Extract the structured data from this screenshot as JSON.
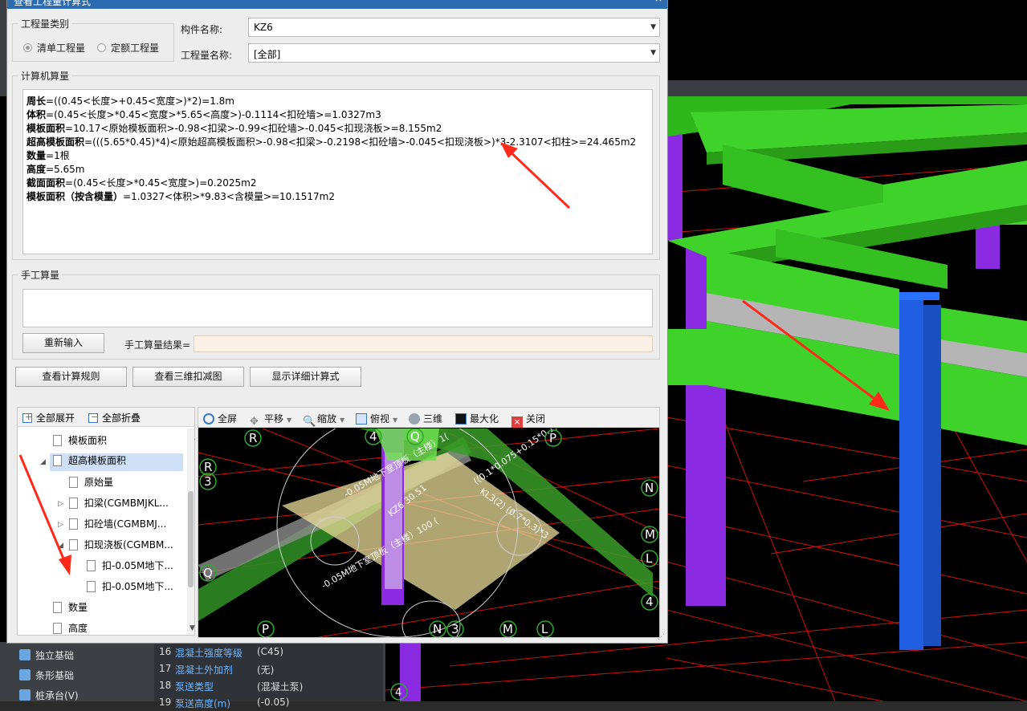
{
  "dialog": {
    "title": "查看工程量计算式",
    "close_label": "×",
    "category_group_label": "工程量类别",
    "radio_qingdan": "清单工程量",
    "radio_dinge": "定额工程量",
    "component_name_label": "构件名称:",
    "component_name_value": "KZ6",
    "quantity_name_label": "工程量名称:",
    "quantity_name_value": "[全部]",
    "computer_calc_label": "计算机算量",
    "manual_calc_label": "手工算量",
    "reinput_button": "重新输入",
    "manual_result_label": "手工算量结果=",
    "buttons": {
      "view_rules": "查看计算规则",
      "view_3d_deduction": "查看三维扣减图",
      "show_detail_formula": "显示详细计算式"
    }
  },
  "calc_lines": [
    {
      "name": "周长",
      "expr": "=((0.45<长度>+0.45<宽度>)*2)=1.8m"
    },
    {
      "name": "体积",
      "expr": "=(0.45<长度>*0.45<宽度>*5.65<高度>)-0.1114<扣砼墙>=1.0327m3"
    },
    {
      "name": "模板面积",
      "expr": "=10.17<原始模板面积>-0.98<扣梁>-0.99<扣砼墙>-0.045<扣现浇板>=8.155m2"
    },
    {
      "name": "超高模板面积",
      "expr": "=(((5.65*0.45)*4)<原始超高模板面积>-0.98<扣梁>-0.2198<扣砼墙>-0.045<扣现浇板>)*3-2.3107<扣柱>=24.465m2"
    },
    {
      "name": "数量",
      "expr": "=1根"
    },
    {
      "name": "高度",
      "expr": "=5.65m"
    },
    {
      "name": "截面面积",
      "expr": "=(0.45<长度>*0.45<宽度>)=0.2025m2"
    },
    {
      "name": "模板面积（按含模量）",
      "expr": "=1.0327<体积>*9.83<含模量>=10.1517m2"
    }
  ],
  "tree": {
    "expand_all": "全部展开",
    "collapse_all": "全部折叠",
    "nodes": [
      {
        "label": "模板面积"
      },
      {
        "label": "超高模板面积"
      },
      {
        "label": "原始量"
      },
      {
        "label": "扣梁(CGMBMJKL..."
      },
      {
        "label": "扣砼墙(CGMBMJ..."
      },
      {
        "label": "扣现浇板(CGMBM..."
      },
      {
        "label": "扣-0.05M地下..."
      },
      {
        "label": "扣-0.05M地下..."
      },
      {
        "label": "数量"
      },
      {
        "label": "高度"
      }
    ]
  },
  "viewer": {
    "toolbar": {
      "fullscreen": "全屏",
      "pan": "平移",
      "zoom": "缩放",
      "topview": "俯视",
      "three_d": "三维",
      "maximize": "最大化",
      "close": "关闭"
    },
    "labels": {
      "slab_top": "-0.05M地下室顶板（主楼）1(",
      "column": "KZ6 30.51",
      "beam": "KL3(2) (0.7*0.3)*3",
      "beam_expr": "((0.1*0.075+0.15*0.1))*3",
      "slab_bottom": "-0.05M地下室顶板（主楼）100 ("
    },
    "axis_markers": [
      "R",
      "4",
      "Q",
      "P",
      "R",
      "3",
      "N",
      "M",
      "L",
      "Q",
      "4",
      "P",
      "N",
      "3",
      "M",
      "L"
    ]
  },
  "background": {
    "nav_items": [
      "独立基础",
      "条形基础",
      "桩承台(V)"
    ],
    "props": [
      {
        "n": "16",
        "k": "混凝土强度等级",
        "v": "(C45)"
      },
      {
        "n": "17",
        "k": "混凝土外加剂",
        "v": "(无)"
      },
      {
        "n": "18",
        "k": "泵送类型",
        "v": "(混凝土泵)"
      },
      {
        "n": "19",
        "k": "泵送高度(m)",
        "v": "(-0.05)"
      }
    ],
    "axis_marker": "4"
  },
  "colors": {
    "title_blue": "#2d6bb1",
    "beam_green": "#3fd22a",
    "column_blue": "#1f5ee0",
    "column_purple": "#8a2be2",
    "arrow_red": "#ff2a1a"
  }
}
